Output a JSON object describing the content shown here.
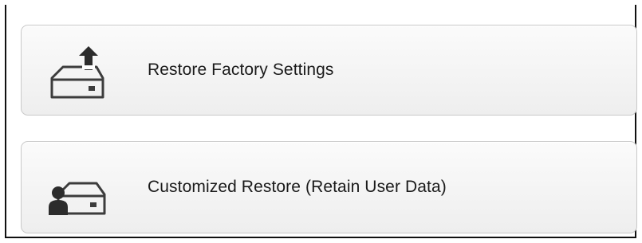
{
  "options": [
    {
      "label": "Restore Factory Settings",
      "icon": "drive-upload-icon"
    },
    {
      "label": "Customized Restore (Retain User Data)",
      "icon": "drive-user-icon"
    }
  ],
  "colors": {
    "icon_stroke": "#3c3c3c",
    "button_border": "#c9c9c9",
    "text": "#1a1a1a"
  }
}
